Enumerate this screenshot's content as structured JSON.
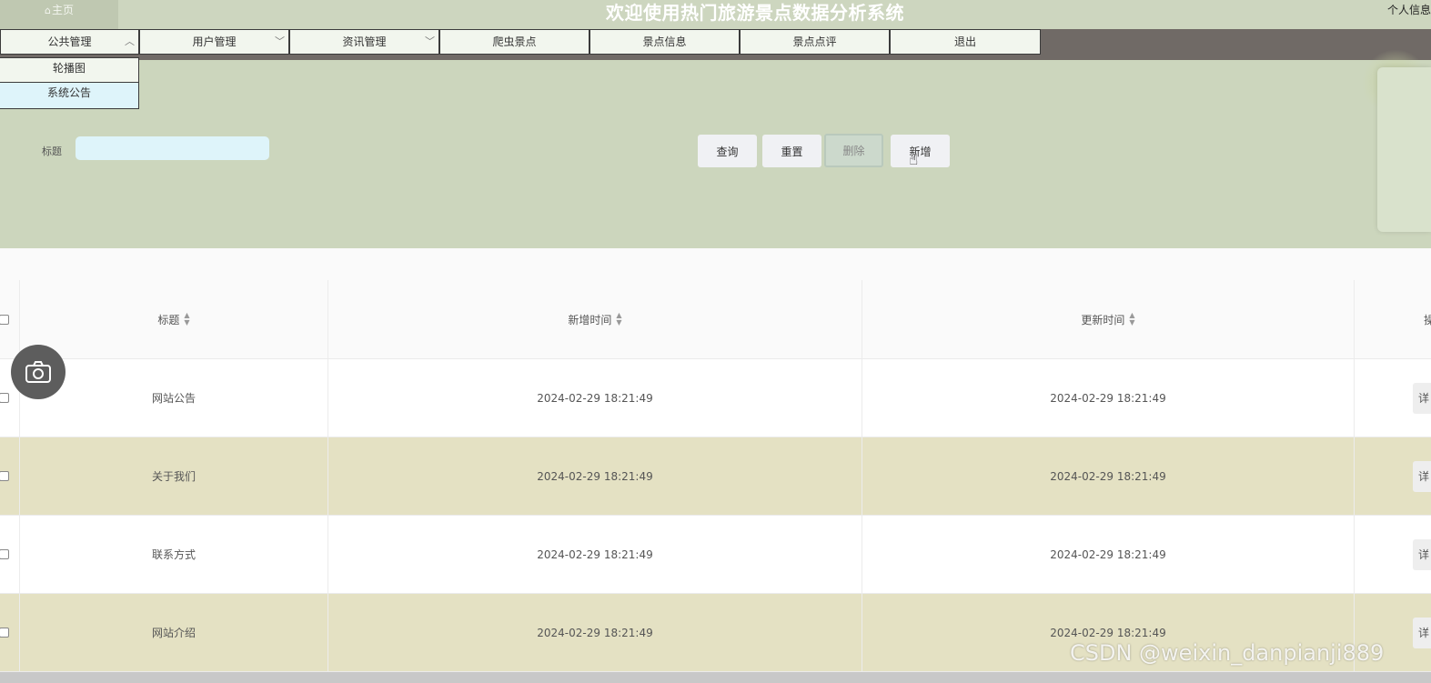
{
  "header": {
    "home_tab": "主页",
    "title": "欢迎使用热门旅游景点数据分析系统",
    "profile": "个人信息"
  },
  "nav": {
    "items": [
      {
        "label": "公共管理",
        "chevron": "up"
      },
      {
        "label": "用户管理",
        "chevron": "down"
      },
      {
        "label": "资讯管理",
        "chevron": "down"
      },
      {
        "label": "爬虫景点"
      },
      {
        "label": "景点信息"
      },
      {
        "label": "景点点评"
      },
      {
        "label": "退出"
      }
    ],
    "dropdown": [
      "轮播图",
      "系统公告"
    ]
  },
  "search": {
    "label": "标题",
    "value": "",
    "placeholder": ""
  },
  "actions": {
    "query": "查询",
    "reset": "重置",
    "delete": "删除",
    "add": "新增"
  },
  "table": {
    "columns": [
      "标题",
      "新增时间",
      "更新时间",
      "操"
    ],
    "rows": [
      {
        "title": "网站公告",
        "added": "2024-02-29 18:21:49",
        "updated": "2024-02-29 18:21:49",
        "op": "详"
      },
      {
        "title": "关于我们",
        "added": "2024-02-29 18:21:49",
        "updated": "2024-02-29 18:21:49",
        "op": "详"
      },
      {
        "title": "联系方式",
        "added": "2024-02-29 18:21:49",
        "updated": "2024-02-29 18:21:49",
        "op": "详"
      },
      {
        "title": "网站介绍",
        "added": "2024-02-29 18:21:49",
        "updated": "2024-02-29 18:21:49",
        "op": "详"
      }
    ]
  },
  "watermark": "CSDN @weixin_danpianji889",
  "icons": {
    "home": "home-icon",
    "camera": "camera-icon",
    "cursor": "hand-pointer-icon",
    "sort": "sort-icon"
  },
  "colors": {
    "topbar": "#cdd6bf",
    "navbar": "#706a66",
    "panel": "#ccd6bd",
    "row_alt": "#e4e1c3",
    "input": "#def4fa"
  }
}
